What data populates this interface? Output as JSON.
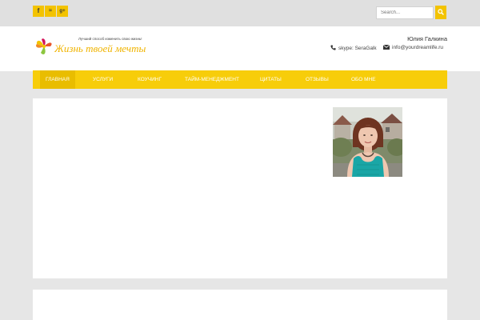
{
  "social": [
    {
      "name": "facebook-icon",
      "glyph": "f"
    },
    {
      "name": "rss-icon",
      "glyph": "≈"
    },
    {
      "name": "google-plus-icon",
      "glyph": "g+"
    }
  ],
  "search": {
    "placeholder": "Search..."
  },
  "logo": {
    "title": "Жизнь твоей мечты",
    "tagline": "Лучший способ изменить свою жизнь!"
  },
  "header": {
    "author": "Юлия Галкина",
    "skype": "skype: SeraGalk",
    "email": "info@yourdreamlife.ru"
  },
  "nav": {
    "items": [
      {
        "label": "ГЛАВНАЯ"
      },
      {
        "label": "УСЛУГИ"
      },
      {
        "label": "КОУЧИНГ"
      },
      {
        "label": "ТАЙМ-МЕНЕДЖМЕНТ"
      },
      {
        "label": "ЦИТАТЫ"
      },
      {
        "label": "ОТЗЫВЫ"
      },
      {
        "label": "ОБО МНЕ"
      }
    ]
  },
  "colors": {
    "accent": "#f7cd0a",
    "accent_dark": "#e9bd00",
    "page_bg": "#e6e6e6"
  }
}
